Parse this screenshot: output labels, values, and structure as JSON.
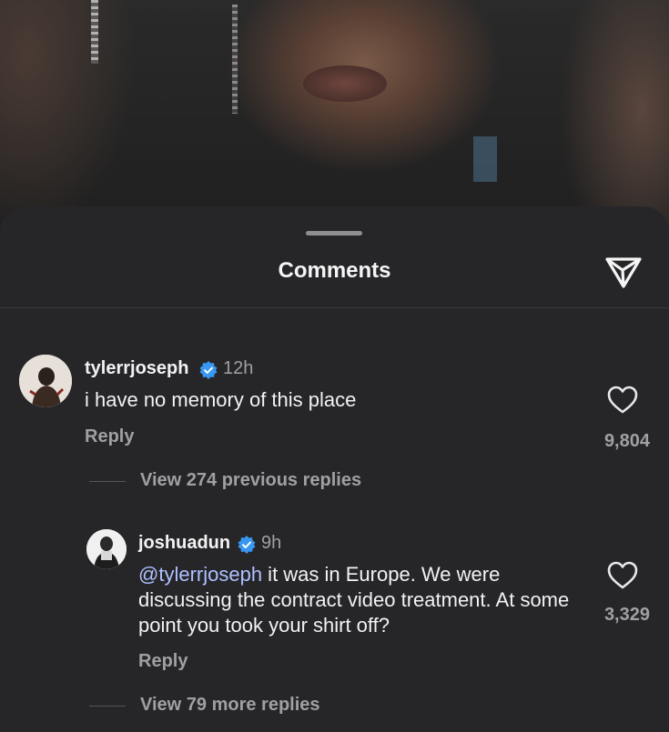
{
  "sheet": {
    "title": "Comments"
  },
  "comments": [
    {
      "username": "tylerrjoseph",
      "verified": true,
      "timestamp": "12h",
      "text": "i have no memory of this place",
      "reply_label": "Reply",
      "likes": "9,804",
      "view_replies": "View 274 previous replies"
    },
    {
      "username": "joshuadun",
      "verified": true,
      "timestamp": "9h",
      "mention": "@tylerrjoseph",
      "text": " it was in Europe. We were discussing the contract video treatment. At some point you took your shirt off?",
      "reply_label": "Reply",
      "likes": "3,329",
      "view_replies": "View 79 more replies"
    }
  ],
  "colors": {
    "sheet_background": "#262629",
    "primary_text": "#f2f2f2",
    "secondary_text": "#a0a0a4",
    "mention": "#b0c0ff",
    "verified_badge": "#3897f0"
  },
  "icons": [
    "send-icon",
    "verified-badge-icon",
    "heart-icon"
  ]
}
